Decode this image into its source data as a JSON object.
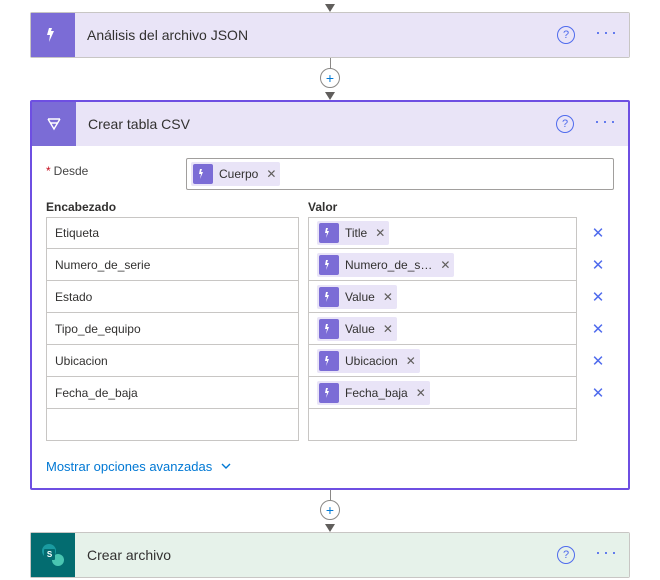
{
  "colors": {
    "purple": "#7b6cd6",
    "token_bg": "#e9e4f7",
    "link": "#0078d4"
  },
  "actions": {
    "parse_json": {
      "title": "Análisis del archivo JSON"
    },
    "create_csv": {
      "title": "Crear tabla CSV",
      "from_label": "Desde",
      "from_token": "Cuerpo",
      "header_col": "Encabezado",
      "value_col": "Valor",
      "rows": [
        {
          "header": "Etiqueta",
          "value_token": "Title"
        },
        {
          "header": "Numero_de_serie",
          "value_token": "Numero_de_s…"
        },
        {
          "header": "Estado",
          "value_token": "Value"
        },
        {
          "header": "Tipo_de_equipo",
          "value_token": "Value"
        },
        {
          "header": "Ubicacion",
          "value_token": "Ubicacion"
        },
        {
          "header": "Fecha_de_baja",
          "value_token": "Fecha_baja"
        }
      ],
      "advanced_label": "Mostrar opciones avanzadas"
    },
    "create_file": {
      "title": "Crear archivo"
    }
  },
  "icons": {
    "data_ops": "data-ops-icon",
    "sharepoint": "sharepoint-icon"
  }
}
